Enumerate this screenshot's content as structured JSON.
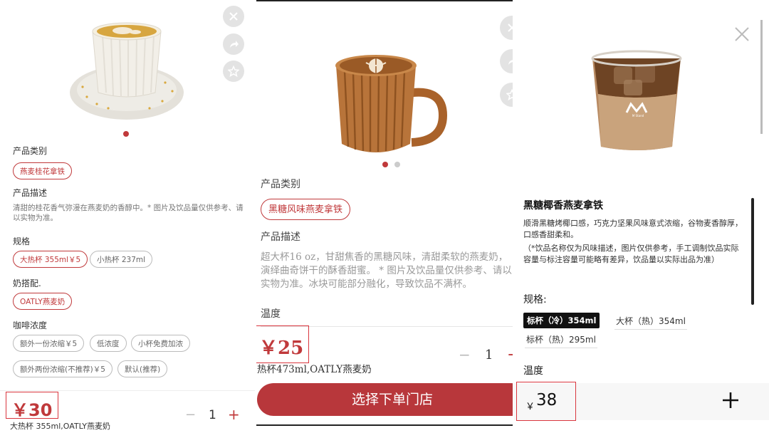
{
  "panel1": {
    "category_title": "产品类别",
    "category_tag": "燕麦桂花拿铁",
    "desc_title": "产品描述",
    "desc_text": "清甜的桂花香气弥漫在燕麦奶的香醇中。* 图片及饮品量仅供参考、请以实物为准。",
    "spec_title": "规格",
    "spec_options": [
      "大热杯 355ml￥5",
      "小热杯 237ml"
    ],
    "milk_title": "奶搭配.",
    "milk_option": "OATLY燕麦奶",
    "strength_title": "咖啡浓度",
    "strength_row1": [
      "额外一份浓缩￥5",
      "低浓度",
      "小杯免费加浓"
    ],
    "strength_row2": [
      "额外两份浓缩(不推荐)￥5",
      "默认(推荐)"
    ],
    "price": "￥30",
    "quantity": "1",
    "summary": "大热杯 355ml,OATLY燕麦奶",
    "icons": [
      "close-icon",
      "share-icon",
      "star-icon"
    ]
  },
  "panel2": {
    "category_title": "产品类别",
    "category_tag": "黑糖风味燕麦拿铁",
    "desc_title": "产品描述",
    "desc_text": "超大杯16 oz，甘甜焦香的黑糖风味，清甜柔软的燕麦奶，演绎曲奇饼干的酥香甜蜜。 * 图片及饮品量仅供参考、请以实物为准。冰块可能部分融化，导致饮品不满杯。",
    "temp_title": "温度",
    "price": "￥25",
    "quantity": "1",
    "summary": "热杯473ml,OATLY燕麦奶",
    "cta": "选择下单门店"
  },
  "panel3": {
    "product_name": "黑糖椰香燕麦拿铁",
    "desc_text": "顺滑黑糖烤椰口感，巧克力坚果风味意式浓缩，谷物麦香醇厚，口感香甜柔和。",
    "note_text": "（*饮品名称仅为风味描述，图片仅供参考，手工调制饮品实际容量与标注容量可能略有差异，饮品量以实际出品为准）",
    "spec_title": "规格:",
    "spec_options": [
      "标杯（冷）354ml",
      "大杯（热）354ml",
      "标杯（热）295ml"
    ],
    "temp_title": "温度",
    "currency": "￥",
    "price": "38",
    "cup_logo": "M",
    "cup_logo_sub": "M Stand"
  },
  "colors": {
    "brand_red": "#c0393b",
    "highlight": "#d9363e"
  }
}
